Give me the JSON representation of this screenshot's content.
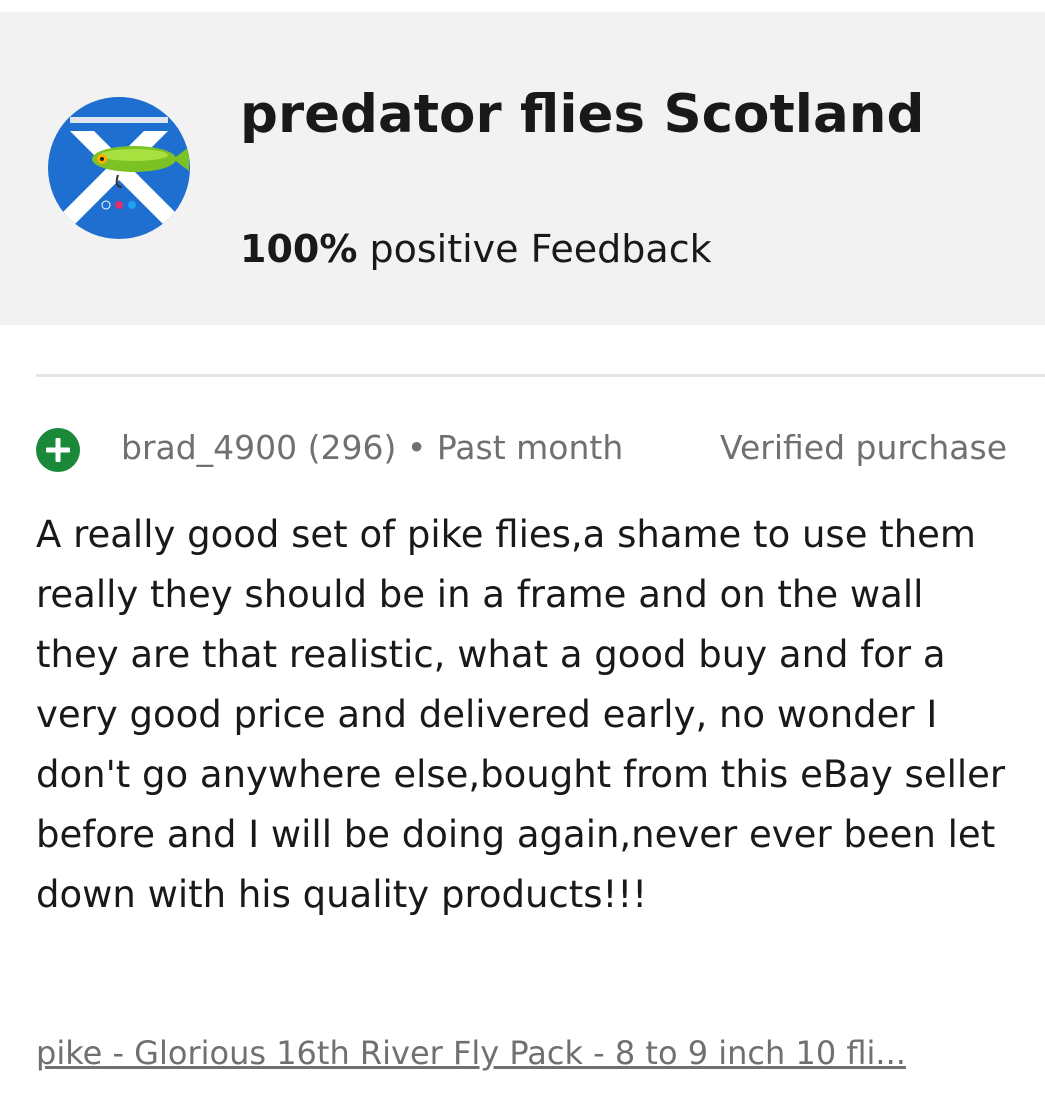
{
  "seller": {
    "name": "predator flies Scotland",
    "feedback_percent": "100%",
    "feedback_label": "positive Feedback",
    "avatar": {
      "icon": "saltire-flag-fish-lure-logo",
      "colors": {
        "flag_blue": "#1f6fd0",
        "flag_white": "#ffffff",
        "lure_green": "#7cc225"
      }
    }
  },
  "review": {
    "rating_icon": "positive-plus-icon",
    "rating_color": "#1a8a3a",
    "reviewer": "brad_4900 (296)",
    "separator": "•",
    "time": "Past month",
    "verified_label": "Verified purchase",
    "text": "A really good set of pike flies,a shame to use them really they should be in a frame and on the wall they are that realistic, what a good buy and for a very good price and delivered early, no wonder I don't go anywhere else,bought from this eBay seller before and I will be doing again,never ever been let down with his quality products!!!",
    "item_link": "pike - Glorious 16th River Fly Pack - 8 to 9 inch 10 fli..."
  }
}
